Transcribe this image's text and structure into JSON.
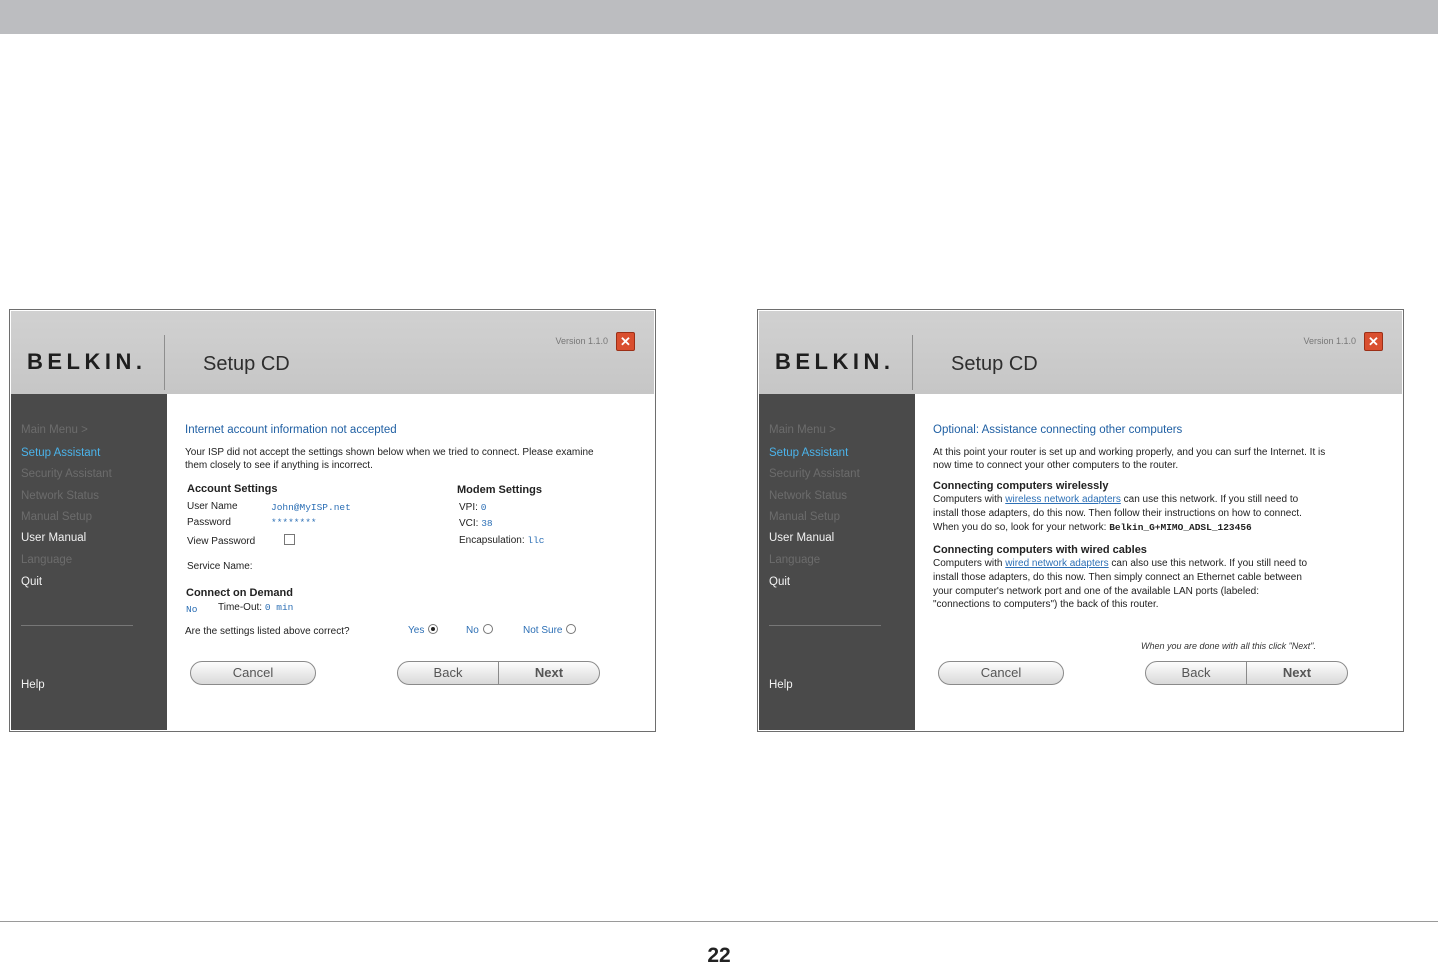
{
  "page": {
    "number": "22"
  },
  "windows": [
    {
      "brand": "BELKIN.",
      "title": "Setup CD",
      "version": "Version 1.1.0",
      "close_glyph": "✕",
      "nav": [
        {
          "label": "Main Menu  >"
        },
        {
          "label": "Setup Assistant"
        },
        {
          "label": "Security Assistant"
        },
        {
          "label": "Network Status"
        },
        {
          "label": "Manual Setup"
        },
        {
          "label": "User Manual"
        },
        {
          "label": "Language"
        },
        {
          "label": "Quit"
        }
      ],
      "help": "Help",
      "heading": "Internet account information not accepted",
      "intro_1": "Your ISP did not accept the settings shown below when we tried to connect. Please examine",
      "intro_2": "them closely to see if anything is incorrect.",
      "account": {
        "title": "Account Settings",
        "username_label": "User Name",
        "username_value": "John@MyISP.net",
        "password_label": "Password",
        "password_value": "********",
        "view_password_label": "View Password",
        "service_name_label": "Service Name:"
      },
      "modem": {
        "title": "Modem Settings",
        "vpi_label": "VPI:",
        "vpi_value": "0",
        "vci_label": "VCI:",
        "vci_value": "38",
        "encap_label": "Encapsulation:",
        "encap_value": "llc"
      },
      "cod": {
        "title": "Connect on Demand",
        "value": "No",
        "timeout_label": "Time-Out:",
        "timeout_value": "0 min"
      },
      "question": "Are the settings listed above correct?",
      "options": [
        "Yes",
        "No",
        "Not Sure"
      ],
      "selected_option": "Yes",
      "buttons": {
        "cancel": "Cancel",
        "back": "Back",
        "next": "Next"
      }
    },
    {
      "brand": "BELKIN.",
      "title": "Setup CD",
      "version": "Version 1.1.0",
      "close_glyph": "✕",
      "nav": [
        {
          "label": "Main Menu  >"
        },
        {
          "label": "Setup Assistant"
        },
        {
          "label": "Security Assistant"
        },
        {
          "label": "Network Status"
        },
        {
          "label": "Manual Setup"
        },
        {
          "label": "User Manual"
        },
        {
          "label": "Language"
        },
        {
          "label": "Quit"
        }
      ],
      "help": "Help",
      "heading": "Optional: Assistance connecting other computers",
      "intro_1": "At this point your router is set up and working properly, and you can surf the Internet. It is",
      "intro_2": "now time to connect your other computers to the router.",
      "wireless": {
        "title": "Connecting computers wirelessly",
        "l1_pre": "Computers with ",
        "l1_link": "wireless network adapters",
        "l1_post": " can use this network. If you still need to",
        "l2": "install those adapters, do this now. Then follow their instructions on how to connect.",
        "l3_pre": "When you do so, look for your network: ",
        "network_name": "Belkin_G+MIMO_ADSL_123456"
      },
      "wired": {
        "title": "Connecting computers with wired cables",
        "l1_pre": "Computers with ",
        "l1_link": "wired network adapters",
        "l1_post": " can also use this network. If you still need to",
        "l2": "install those adapters, do this now. Then simply connect an Ethernet cable between",
        "l3": "your computer's network port and one of the available LAN ports (labeled:",
        "l4": "\"connections to computers\") the back of this router."
      },
      "done_note": "When you are done with all this click \"Next\".",
      "buttons": {
        "cancel": "Cancel",
        "back": "Back",
        "next": "Next"
      }
    }
  ]
}
